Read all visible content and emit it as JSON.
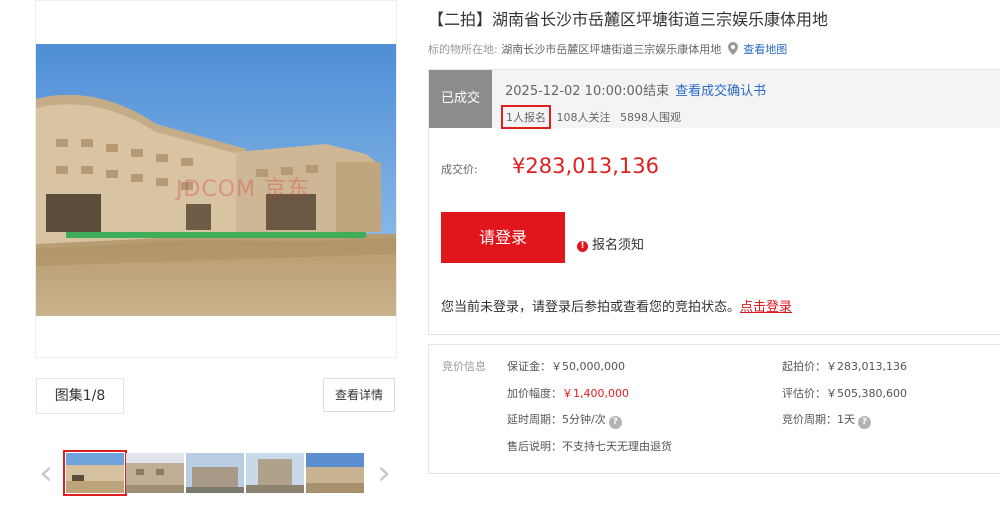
{
  "title": "【二拍】湖南省长沙市岳麓区坪塘街道三宗娱乐康体用地",
  "location": {
    "label": "标的物所在地:",
    "value": "湖南长沙市岳麓区坪塘街道三宗娱乐康体用地",
    "map_link": "查看地图"
  },
  "gallery": {
    "watermark": "JDCOM 京东",
    "counter": "图集1/8",
    "view_detail": "查看详情",
    "prev_arrow": "‹",
    "next_arrow": "›"
  },
  "status": {
    "badge": "已成交",
    "end_time": "2025-12-02 10:00:00结束",
    "confirm_link": "查看成交确认书",
    "signups": "1人报名",
    "followers": "108人关注",
    "viewers": "5898人围观"
  },
  "price": {
    "label": "成交价:",
    "value": "¥283,013,136"
  },
  "login": {
    "button": "请登录",
    "notice": "报名须知",
    "notice_icon": "!",
    "tip": "您当前未登录，请登录后参拍或查看您的竞拍状态。",
    "tip_link": "点击登录"
  },
  "bid_info": {
    "section_label": "竞价信息",
    "deposit": "保证金：￥50,000,000",
    "increment_label": "加价幅度：",
    "increment_value": "￥1,400,000",
    "delay": "延时周期：5分钟/次",
    "after_sale": "售后说明：不支持七天无理由退货",
    "start_price": "起拍价：￥283,013,136",
    "appraisal": "评估价：￥505,380,600",
    "cycle": "竞价周期：1天",
    "help_icon": "?"
  },
  "colors": {
    "accent_red": "#e0161c",
    "link_blue": "#2a6ac8",
    "badge_gray": "#8c8c8c"
  }
}
